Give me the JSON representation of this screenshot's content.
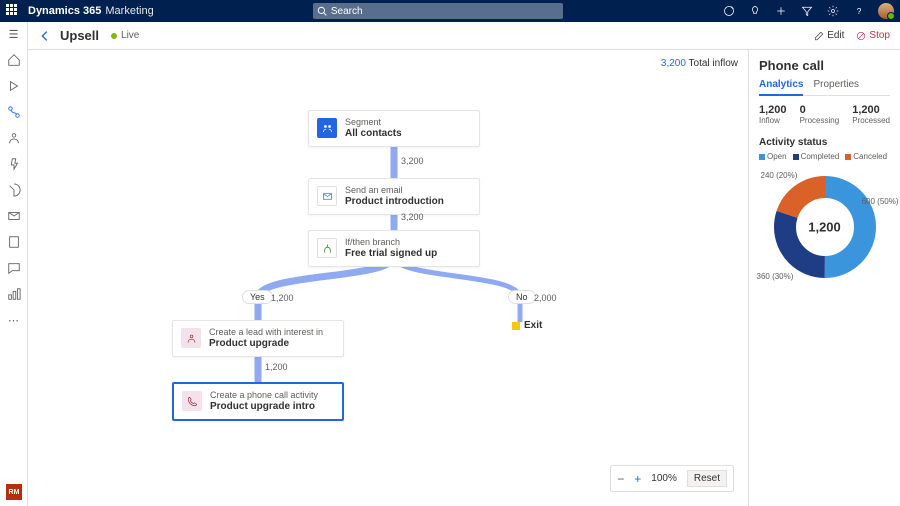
{
  "topbar": {
    "product": "Dynamics 365",
    "module": "Marketing",
    "search_placeholder": "Search"
  },
  "page": {
    "title": "Upsell",
    "status_label": "Live",
    "edit_label": "Edit",
    "stop_label": "Stop"
  },
  "canvas": {
    "total_inflow": {
      "value": "3,200",
      "label": "Total inflow"
    },
    "nodes": {
      "segment": {
        "sub": "Segment",
        "label": "All contacts"
      },
      "email": {
        "sub": "Send an email",
        "label": "Product introduction"
      },
      "branch": {
        "sub": "If/then branch",
        "label": "Free trial signed up"
      },
      "lead": {
        "sub": "Create a lead with interest in",
        "label": "Product upgrade"
      },
      "phone": {
        "sub": "Create a phone call activity",
        "label": "Product upgrade intro"
      }
    },
    "connectors": {
      "seg_to_email": "3,200",
      "email_to_branch": "3,200",
      "yes": {
        "label": "Yes",
        "count": "1,200"
      },
      "no": {
        "label": "No",
        "count": "2,000"
      },
      "lead_to_phone": "1,200"
    },
    "exit_label": "Exit",
    "zoom": {
      "percent": "100%",
      "reset": "Reset"
    }
  },
  "right_pane": {
    "title": "Phone call",
    "tabs": {
      "analytics": "Analytics",
      "properties": "Properties"
    },
    "stats": {
      "inflow": {
        "value": "1,200",
        "label": "Inflow"
      },
      "processing": {
        "value": "0",
        "label": "Processing"
      },
      "processed": {
        "value": "1,200",
        "label": "Processed"
      }
    },
    "activity_status_title": "Activity status",
    "legend": {
      "open": "Open",
      "completed": "Completed",
      "canceled": "Canceled"
    },
    "donut": {
      "center": "1,200",
      "labels": {
        "top_left": "240 (20%)",
        "right": "600 (50%)",
        "bottom_left": "360 (30%)"
      }
    }
  },
  "chart_data": {
    "type": "pie",
    "title": "Activity status",
    "series": [
      {
        "name": "Open",
        "value": 600,
        "percent": 50,
        "color": "#3A95DD"
      },
      {
        "name": "Completed",
        "value": 360,
        "percent": 30,
        "color": "#1F3D85"
      },
      {
        "name": "Canceled",
        "value": 240,
        "percent": 20,
        "color": "#DA6127"
      }
    ],
    "total": 1200
  },
  "rm_badge": "RM"
}
